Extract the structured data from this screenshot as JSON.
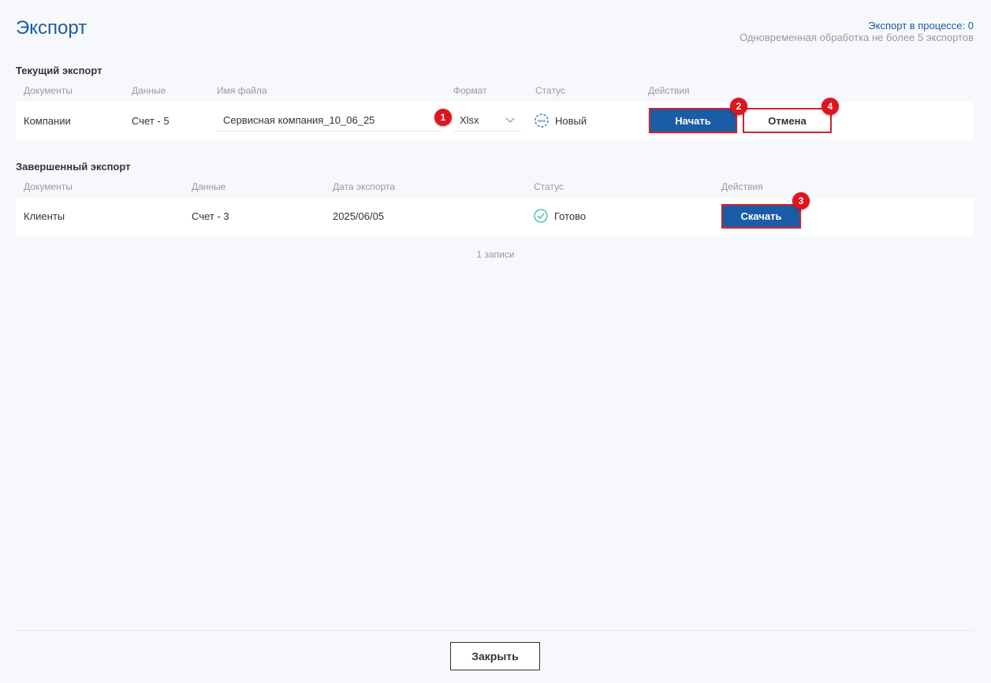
{
  "header": {
    "title": "Экспорт",
    "in_progress": "Экспорт в процессе: 0",
    "limit_note": "Одновременная обработка не более 5 экспортов"
  },
  "current_export": {
    "section_title": "Текущий экспорт",
    "columns": [
      "Документы",
      "Данные",
      "Имя файла",
      "Формат",
      "Статус",
      "Действия"
    ],
    "row": {
      "document": "Компании",
      "data": "Счет - 5",
      "filename": "Сервисная компания_10_06_25",
      "format": "Xlsx",
      "status_icon_text": "NEW",
      "status": "Новый",
      "start_label": "Начать",
      "cancel_label": "Отмена"
    }
  },
  "completed_export": {
    "section_title": "Завершенный экспорт",
    "columns": [
      "Документы",
      "Данные",
      "Дата экспорта",
      "Статус",
      "Действия"
    ],
    "row": {
      "document": "Клиенты",
      "data": "Счет - 3",
      "date": "2025/06/05",
      "status": "Готово",
      "download_label": "Скачать"
    },
    "records_count": "1 записи"
  },
  "badges": {
    "b1": "1",
    "b2": "2",
    "b3": "3",
    "b4": "4"
  },
  "footer": {
    "close_label": "Закрыть"
  },
  "colors": {
    "accent": "#1a5ca6",
    "highlight_border": "#c7272f",
    "badge": "#e0141e",
    "success": "#2bb59a"
  },
  "icons": {
    "format_dropdown": "chevron-down-icon",
    "new_status": "new-status-icon",
    "done_status": "check-circle-icon"
  }
}
